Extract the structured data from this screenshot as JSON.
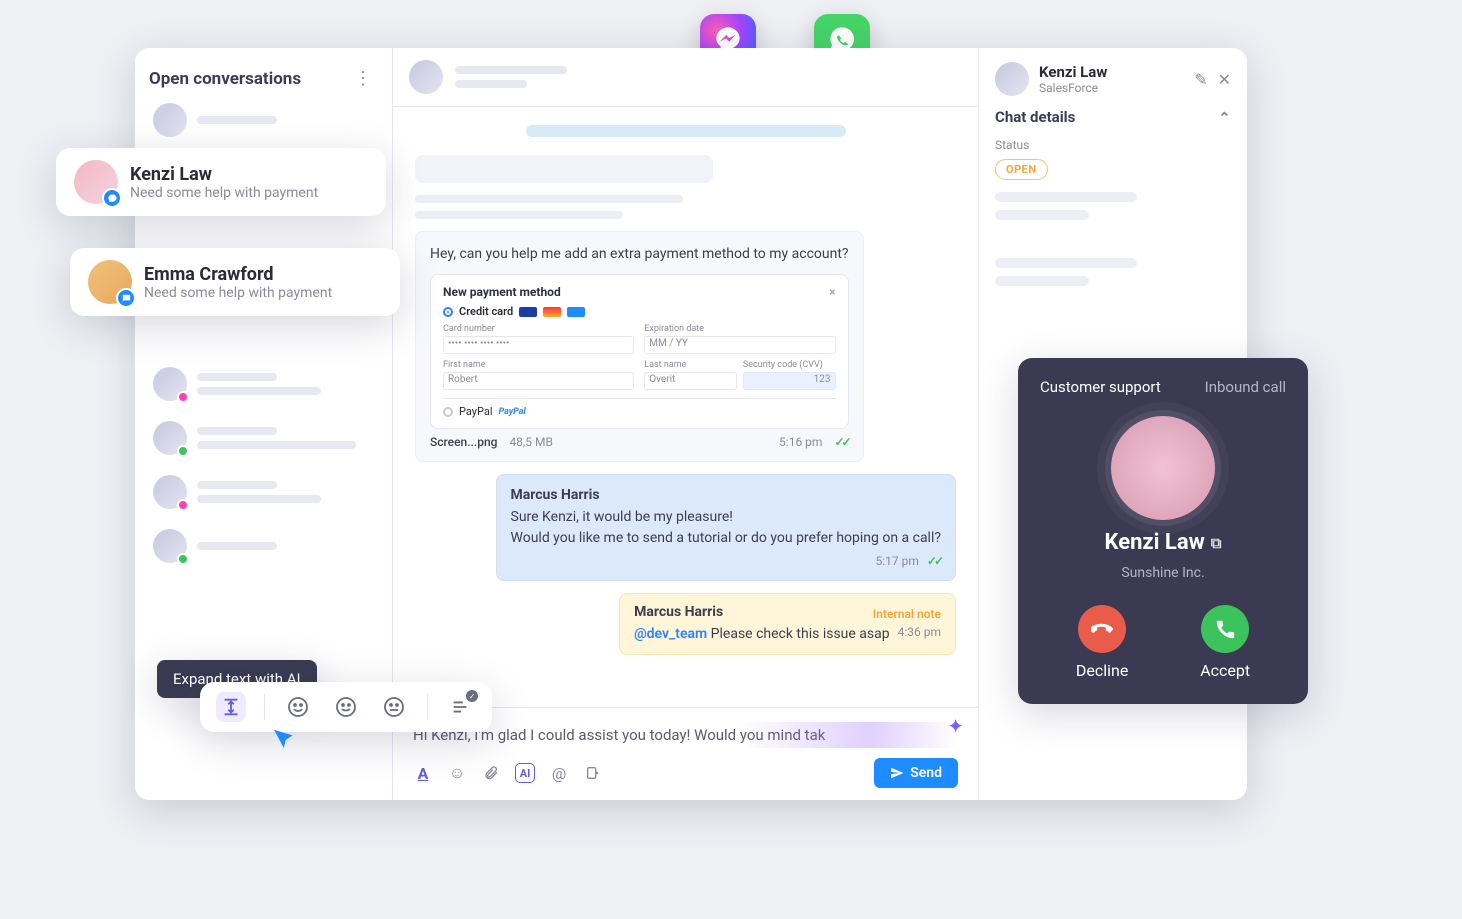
{
  "sidebar": {
    "title": "Open conversations"
  },
  "float_cards": [
    {
      "name": "Kenzi Law",
      "sub": "Need some help with payment"
    },
    {
      "name": "Emma Crawford",
      "sub": "Need some help with payment"
    }
  ],
  "conversation": {
    "incoming_message": "Hey, can you help me add an extra payment method to my account?",
    "attachment": {
      "title": "New payment method",
      "option_cc": "Credit card",
      "card_number_label": "Card number",
      "exp_label": "Expiration date",
      "exp_placeholder_mm": "MM",
      "exp_placeholder_yy": "YY",
      "first_name_label": "First name",
      "first_name_value": "Robert",
      "last_name_label": "Last name",
      "last_name_value": "Overit",
      "cvv_label": "Security code (CVV)",
      "cvv_value": "123",
      "option_paypal": "PayPal",
      "file_name": "Screen...png",
      "file_size": "48,5 MB",
      "file_time": "5:16 pm"
    },
    "reply": {
      "sender": "Marcus Harris",
      "body": "Sure Kenzi, it would be my pleasure!\nWould you like me to send a tutorial or do you prefer hoping on a call?",
      "time": "5:17 pm"
    },
    "note": {
      "sender": "Marcus Harris",
      "tag": "Internal note",
      "mention": "@dev_team",
      "body": "Please check this issue asap",
      "time": "4:36 pm"
    },
    "compose_text": "Hi Kenzi, I'm glad I could assist you today! Would you mind tak",
    "send_label": "Send"
  },
  "details": {
    "name": "Kenzi Law",
    "source": "SalesForce",
    "section_title": "Chat details",
    "status_label": "Status",
    "status_value": "OPEN"
  },
  "tooltip": {
    "label": "Expand text with AI"
  },
  "call": {
    "left": "Customer support",
    "right": "Inbound call",
    "name": "Kenzi Law",
    "company": "Sunshine Inc.",
    "decline": "Decline",
    "accept": "Accept"
  }
}
